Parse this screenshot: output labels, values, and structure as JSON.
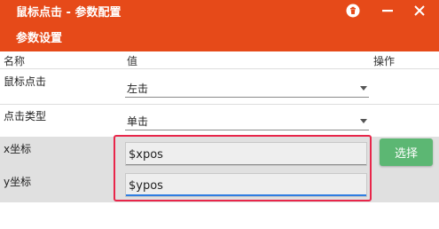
{
  "window": {
    "title": "鼠标点击 - 参数配置",
    "accent_color": "#e64a19",
    "buttons": [
      "delete-icon",
      "minimize-icon",
      "close-icon"
    ]
  },
  "section": {
    "title": "参数设置"
  },
  "table": {
    "headers": {
      "name": "名称",
      "value": "值",
      "action": "操作"
    },
    "rows": [
      {
        "label": "鼠标点击",
        "type": "select",
        "value": "左击"
      },
      {
        "label": "点击类型",
        "type": "select",
        "value": "单击"
      },
      {
        "label": "x坐标",
        "type": "input",
        "value": "$xpos",
        "action_label": "选择"
      },
      {
        "label": "y坐标",
        "type": "input",
        "value": "$ypos",
        "focused": true
      }
    ]
  },
  "colors": {
    "highlight": "#e8264a",
    "action_button": "#5cb773",
    "focus_underline": "#2f7de1"
  }
}
